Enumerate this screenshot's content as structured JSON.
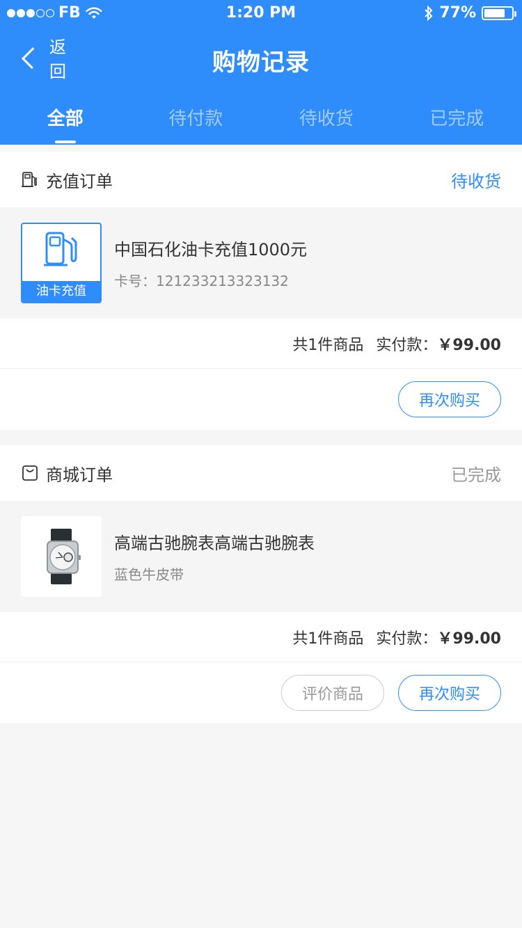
{
  "status_bar": {
    "carrier": "FB",
    "time": "1:20 PM",
    "battery": "77%",
    "battery_level": 0.77,
    "signal_bars": 3
  },
  "nav": {
    "back_label": "返回",
    "title": "购物记录"
  },
  "tabs": [
    {
      "label": "全部",
      "active": true
    },
    {
      "label": "待付款",
      "active": false
    },
    {
      "label": "待收货",
      "active": false
    },
    {
      "label": "已完成",
      "active": false
    }
  ],
  "colors": {
    "brand_blue": "#2f8dfb"
  },
  "orders": [
    {
      "type_label": "充值订单",
      "type_icon": "fuel-pump-icon",
      "status": "待收货",
      "item": {
        "thumb_label": "油卡充值",
        "name": "中国石化油卡充值1000元",
        "sub": "卡号：121233213323132"
      },
      "summary": {
        "count": "共1件商品",
        "paid_label": "实付款：",
        "paid_amount": "￥99.00"
      },
      "actions": [
        {
          "label": "再次购买"
        }
      ]
    },
    {
      "type_label": "商城订单",
      "type_icon": "shopping-bag-icon",
      "status": "已完成",
      "item": {
        "name": "高端古驰腕表高端古驰腕表",
        "sub": "蓝色牛皮带"
      },
      "summary": {
        "count": "共1件商品",
        "paid_label": "实付款：",
        "paid_amount": "￥99.00"
      },
      "actions": [
        {
          "label": "评价商品"
        },
        {
          "label": "再次购买"
        }
      ]
    }
  ]
}
